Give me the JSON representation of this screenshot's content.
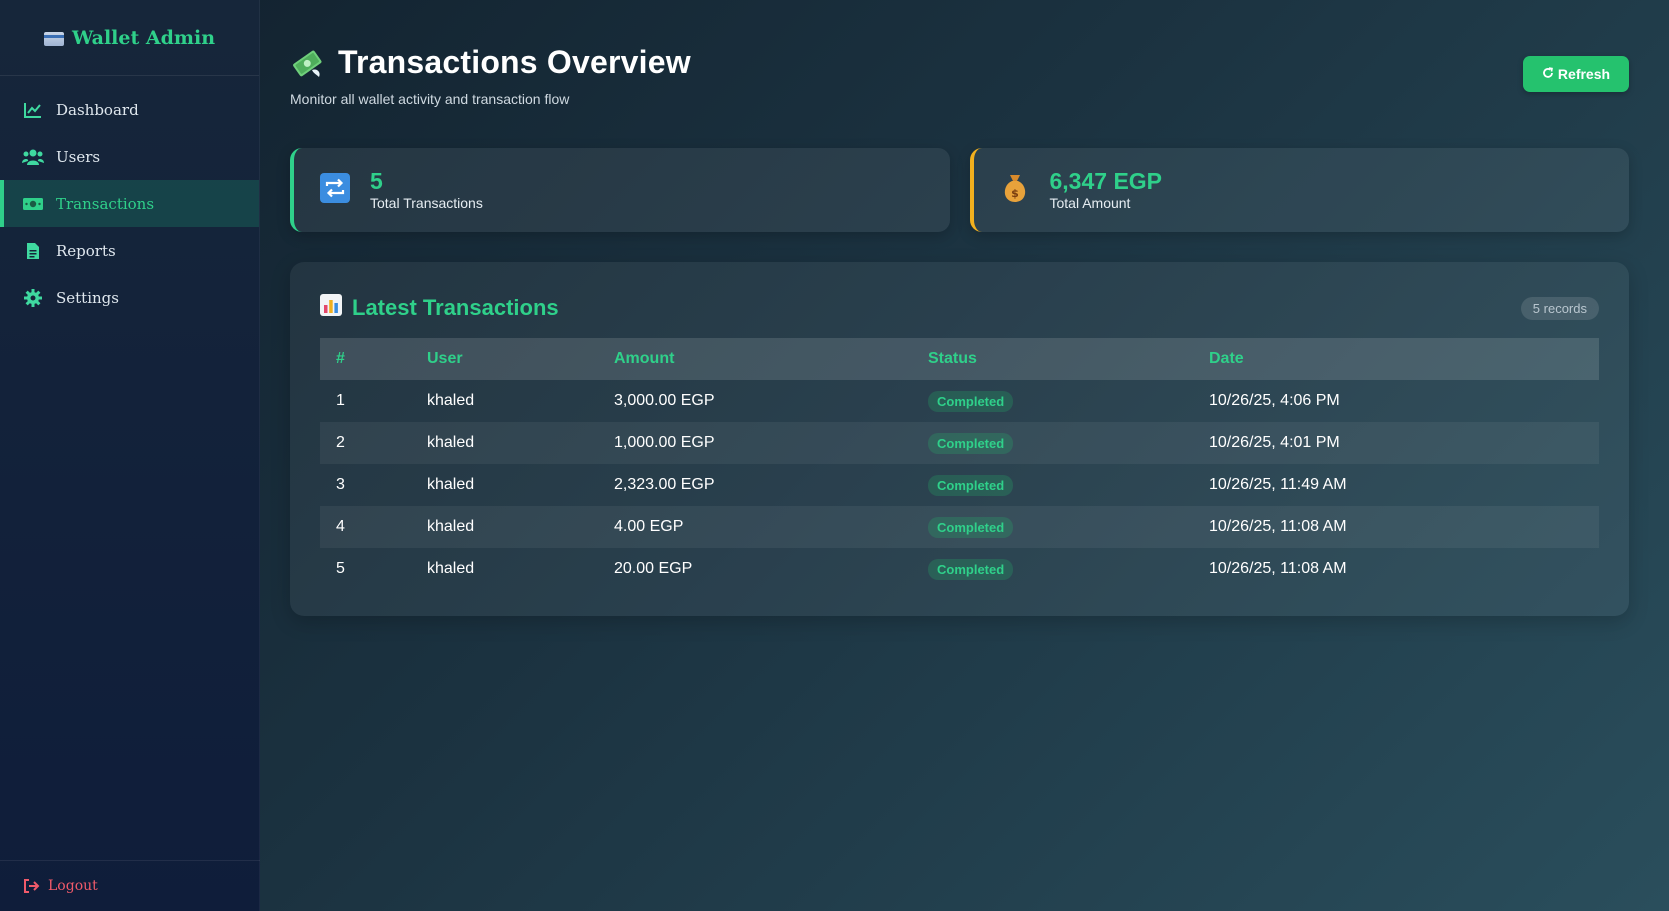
{
  "sidebar": {
    "brand": "Wallet Admin",
    "items": [
      {
        "label": "Dashboard",
        "icon": "chart-line-icon",
        "active": false
      },
      {
        "label": "Users",
        "icon": "users-icon",
        "active": false
      },
      {
        "label": "Transactions",
        "icon": "money-bill-icon",
        "active": true
      },
      {
        "label": "Reports",
        "icon": "file-icon",
        "active": false
      },
      {
        "label": "Settings",
        "icon": "gear-icon",
        "active": false
      }
    ],
    "logout": "Logout"
  },
  "header": {
    "title": "Transactions Overview",
    "subtitle": "Monitor all wallet activity and transaction flow",
    "refresh_label": "Refresh"
  },
  "stats": {
    "total_transactions": {
      "value": "5",
      "label": "Total Transactions"
    },
    "total_amount": {
      "value": "6,347 EGP",
      "label": "Total Amount"
    }
  },
  "table": {
    "title": "Latest Transactions",
    "records": "5 records",
    "columns": [
      "#",
      "User",
      "Amount",
      "Status",
      "Date"
    ],
    "rows": [
      {
        "num": "1",
        "user": "khaled",
        "amount": "3,000.00 EGP",
        "status": "Completed",
        "date": "10/26/25, 4:06 PM"
      },
      {
        "num": "2",
        "user": "khaled",
        "amount": "1,000.00 EGP",
        "status": "Completed",
        "date": "10/26/25, 4:01 PM"
      },
      {
        "num": "3",
        "user": "khaled",
        "amount": "2,323.00 EGP",
        "status": "Completed",
        "date": "10/26/25, 11:49 AM"
      },
      {
        "num": "4",
        "user": "khaled",
        "amount": "4.00 EGP",
        "status": "Completed",
        "date": "10/26/25, 11:08 AM"
      },
      {
        "num": "5",
        "user": "khaled",
        "amount": "20.00 EGP",
        "status": "Completed",
        "date": "10/26/25, 11:08 AM"
      }
    ]
  },
  "colors": {
    "accent": "#2fd08a",
    "amber": "#f2b01e",
    "danger": "#f05a6a",
    "button": "#25c26e"
  }
}
